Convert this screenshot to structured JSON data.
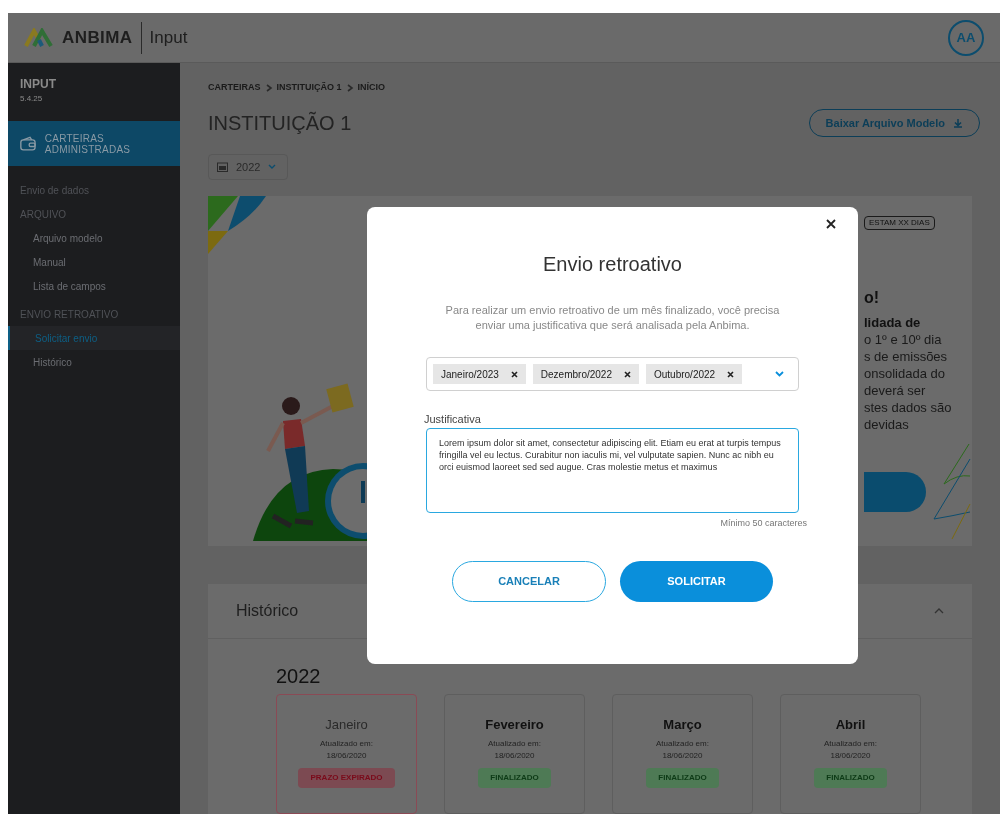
{
  "header": {
    "logo_text": "ANBIMA",
    "app_name": "Input",
    "avatar": "AA"
  },
  "sidebar": {
    "title": "INPUT",
    "version": "5.4.25",
    "section": {
      "label": "CARTEIRAS ADMINISTRADAS",
      "selected": true
    },
    "items": [
      {
        "label": "Envio de dados",
        "selected": false
      },
      {
        "label": "ARQUIVO",
        "selected": false,
        "children": [
          {
            "label": "Arquivo modelo",
            "selected": false
          },
          {
            "label": "Manual",
            "selected": false
          },
          {
            "label": "Lista de campos",
            "selected": false
          }
        ]
      },
      {
        "label": "ENVIO RETROATIVO",
        "selected": false,
        "children": [
          {
            "label": "Solicitar envio",
            "selected": true
          },
          {
            "label": "Histórico",
            "selected": false
          }
        ]
      }
    ]
  },
  "breadcrumb": [
    "CARTEIRAS",
    "INSTITUIÇÃO 1",
    "INÍCIO"
  ],
  "page_title": "INSTITUIÇÃO 1",
  "download_button": "Baixar Arquivo Modelo",
  "year_select": "2022",
  "banner": {
    "badge": "ESTAM XX DIAS",
    "heading": "o!",
    "lines": [
      "lidada de",
      "o 1º e 10º dia",
      "s de emissões",
      "onsolidada do",
      "deverá ser",
      "stes dados são",
      "devidas"
    ]
  },
  "history": {
    "title": "Histórico",
    "expanded": true,
    "year": "2022",
    "months": [
      {
        "name": "Janeiro",
        "updated_label": "Atualizado em:",
        "date": "18/06/2020",
        "status": "PRAZO EXPIRADO",
        "kind": "expired"
      },
      {
        "name": "Fevereiro",
        "updated_label": "Atualizado em:",
        "date": "18/06/2020",
        "status": "FINALIZADO",
        "kind": "done"
      },
      {
        "name": "Março",
        "updated_label": "Atualizado em:",
        "date": "18/06/2020",
        "status": "FINALIZADO",
        "kind": "done"
      },
      {
        "name": "Abril",
        "updated_label": "Atualizado em:",
        "date": "18/06/2020",
        "status": "FINALIZADO",
        "kind": "done"
      }
    ]
  },
  "modal": {
    "title": "Envio retroativo",
    "description": "Para realizar um envio retroativo de um mês finalizado, você precisa enviar uma justificativa que será analisada pela Anbima.",
    "selected_months": [
      "Janeiro/2023",
      "Dezembro/2022",
      "Outubro/2022"
    ],
    "field_label": "Justificativa",
    "justification": "Lorem ipsum dolor sit amet, consectetur adipiscing elit. Etiam eu erat at turpis tempus fringilla vel eu lectus. Curabitur non iaculis mi, vel vulputate sapien. Nunc ac nibh eu orci euismod laoreet sed sed augue. Cras molestie metus et maximus",
    "hint": "Mínimo 50 caracteres",
    "cancel_button": "CANCELAR",
    "submit_button": "SOLICITAR"
  }
}
